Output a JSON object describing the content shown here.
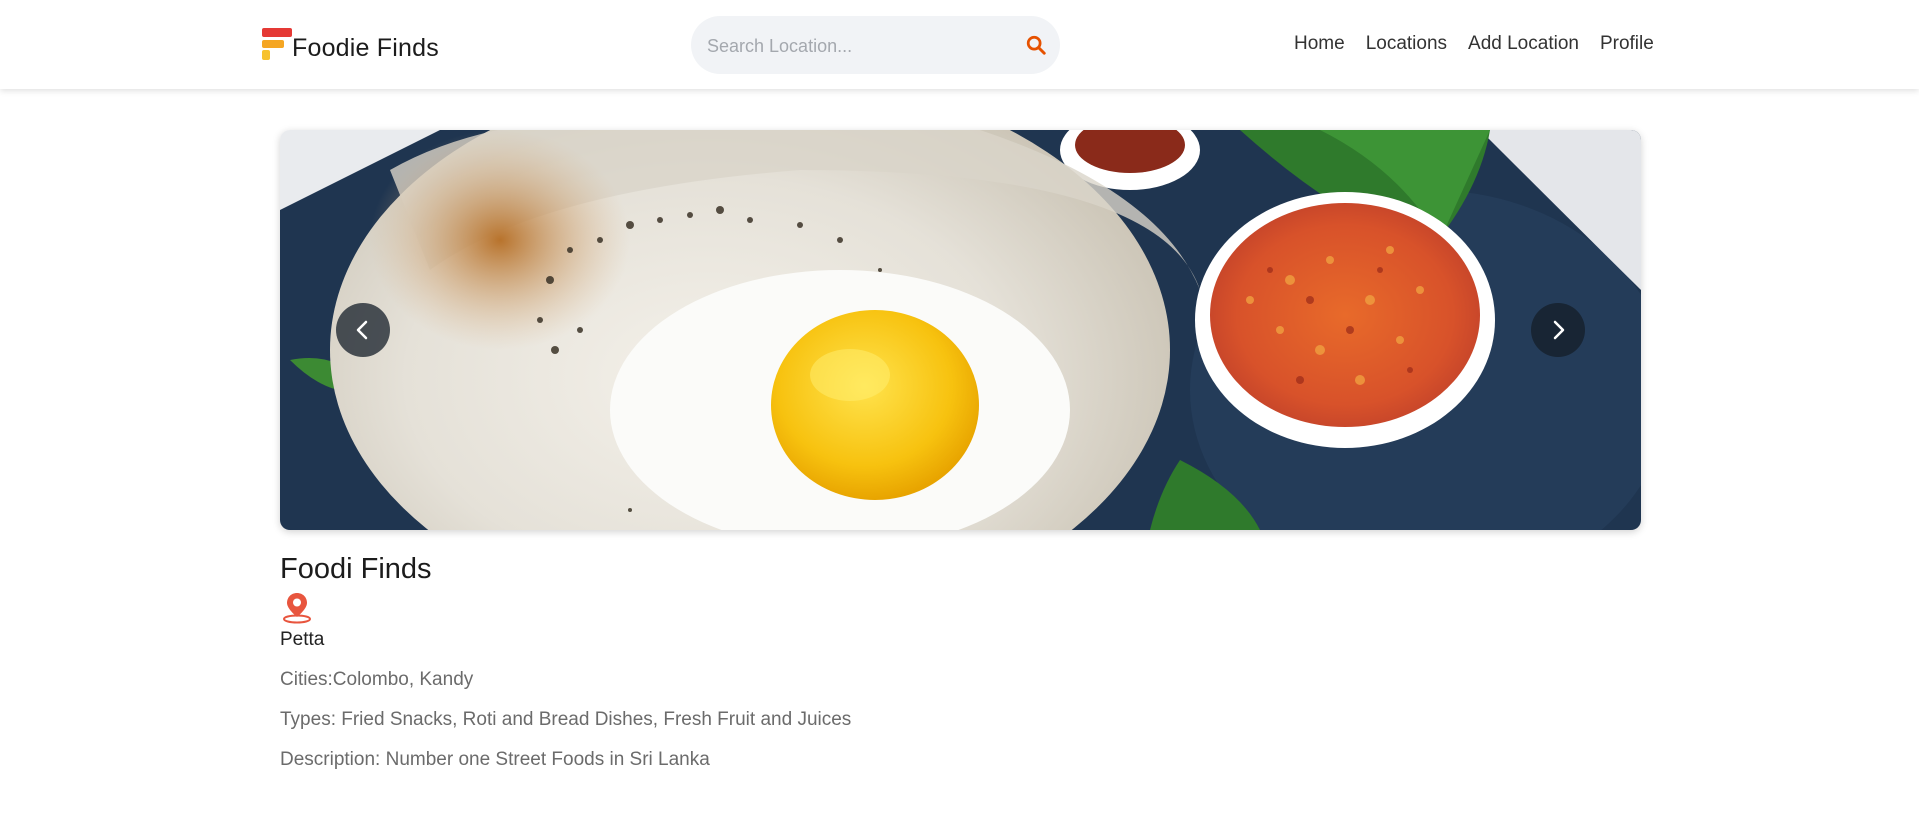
{
  "header": {
    "brand": "Foodie Finds",
    "search_placeholder": "Search Location...",
    "nav": [
      {
        "label": "Home"
      },
      {
        "label": "Locations"
      },
      {
        "label": "Add Location"
      },
      {
        "label": "Profile"
      }
    ]
  },
  "colors": {
    "accent_red": "#e53935",
    "accent_orange": "#f5a623",
    "search_icon": "#e65100",
    "pin": "#e8553e"
  },
  "carousel": {
    "image_alt": "Egg hopper with sambol",
    "prev_icon": "chevron-left-icon",
    "next_icon": "chevron-right-icon"
  },
  "details": {
    "title": "Foodi Finds",
    "place": "Petta",
    "cities": "Cities:Colombo, Kandy",
    "types": "Types: Fried Snacks, Roti and Bread Dishes, Fresh Fruit and Juices",
    "description": "Description: Number one Street Foods in Sri Lanka"
  }
}
